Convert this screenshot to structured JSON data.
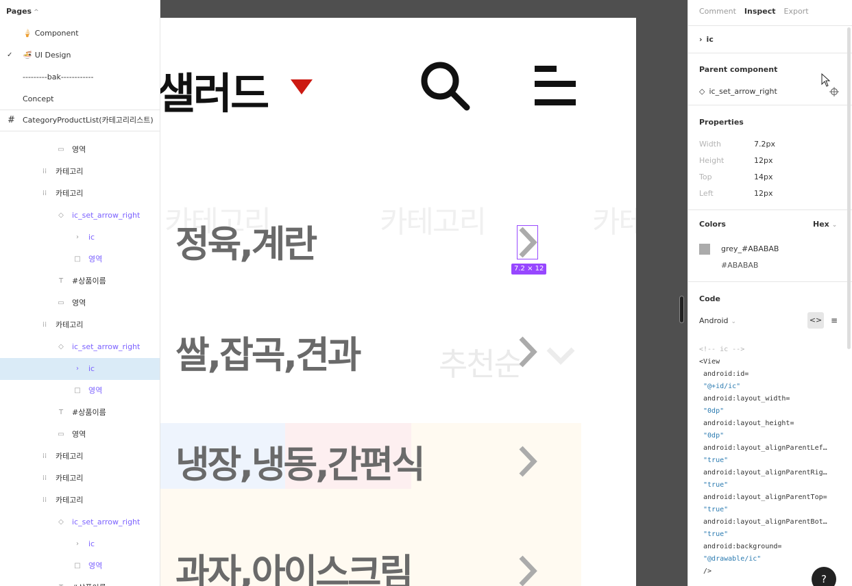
{
  "left_panel": {
    "pages_header": "Pages",
    "pages": [
      {
        "emoji": "🍦",
        "label": "Component",
        "checked": false
      },
      {
        "emoji": "🍜",
        "label": "UI Design",
        "checked": true
      },
      {
        "emoji": "",
        "label": "---------bak------------",
        "checked": false
      },
      {
        "emoji": "",
        "label": "Concept",
        "checked": false
      }
    ],
    "frame": "CategoryProductList(카테고리리스트)",
    "layers": [
      {
        "icon": "rect",
        "label": "영역",
        "purple": false,
        "selected": false
      },
      {
        "icon": "frame",
        "label": "카테고리",
        "purple": false,
        "selected": false
      },
      {
        "icon": "frame",
        "label": "카테고리",
        "purple": false,
        "selected": false
      },
      {
        "icon": "component",
        "label": "ic_set_arrow_right",
        "purple": true,
        "selected": false
      },
      {
        "icon": "chev",
        "label": "ic",
        "purple": true,
        "selected": false
      },
      {
        "icon": "square",
        "label": "영역",
        "purple": true,
        "selected": false
      },
      {
        "icon": "text",
        "label": "#상품이름",
        "purple": false,
        "selected": false
      },
      {
        "icon": "rect",
        "label": "영역",
        "purple": false,
        "selected": false
      },
      {
        "icon": "frame",
        "label": "카테고리",
        "purple": false,
        "selected": false
      },
      {
        "icon": "component",
        "label": "ic_set_arrow_right",
        "purple": true,
        "selected": false
      },
      {
        "icon": "chev",
        "label": "ic",
        "purple": true,
        "selected": true
      },
      {
        "icon": "square",
        "label": "영역",
        "purple": true,
        "selected": false
      },
      {
        "icon": "text",
        "label": "#상품이름",
        "purple": false,
        "selected": false
      },
      {
        "icon": "rect",
        "label": "영역",
        "purple": false,
        "selected": false
      },
      {
        "icon": "frame",
        "label": "카테고리",
        "purple": false,
        "selected": false
      },
      {
        "icon": "frame",
        "label": "카테고리",
        "purple": false,
        "selected": false
      },
      {
        "icon": "frame",
        "label": "카테고리",
        "purple": false,
        "selected": false
      },
      {
        "icon": "component",
        "label": "ic_set_arrow_right",
        "purple": true,
        "selected": false
      },
      {
        "icon": "chev",
        "label": "ic",
        "purple": true,
        "selected": false
      },
      {
        "icon": "square",
        "label": "영역",
        "purple": true,
        "selected": false
      },
      {
        "icon": "text",
        "label": "#상품이름",
        "purple": false,
        "selected": false
      }
    ]
  },
  "canvas": {
    "title": "샐러드",
    "ghost_label": "카테고리",
    "categories": [
      "정육,계란",
      "쌀,잡곡,견과",
      "냉장,냉동,간편식",
      "과자,아이스크림"
    ],
    "ghost_sort": "추천순",
    "size_badge": "7.2 × 12",
    "accent_red": "#CC1A12",
    "arrow_color": "#ABABAB",
    "selection_color": "#9747FF"
  },
  "right_panel": {
    "tabs": [
      {
        "label": "Comment",
        "active": false
      },
      {
        "label": "Inspect",
        "active": true
      },
      {
        "label": "Export",
        "active": false
      }
    ],
    "layer_name": "ic",
    "parent_title": "Parent component",
    "parent_name": "ic_set_arrow_right",
    "properties_title": "Properties",
    "properties": [
      {
        "key": "Width",
        "value": "7.2px"
      },
      {
        "key": "Height",
        "value": "12px"
      },
      {
        "key": "Top",
        "value": "14px"
      },
      {
        "key": "Left",
        "value": "12px"
      }
    ],
    "colors_title": "Colors",
    "color_format": "Hex",
    "color_name": "grey_#ABABAB",
    "color_hex": "#ABABAB",
    "code_title": "Code",
    "code_lang": "Android",
    "code_comment": "<!-- ic -->",
    "code_lines": [
      "<View",
      " android:id=",
      " \"@+id/ic\"",
      " android:layout_width=",
      " \"0dp\"",
      " android:layout_height=",
      " \"0dp\"",
      " android:layout_alignParentLef…",
      " \"true\"",
      " android:layout_alignParentRig…",
      " \"true\"",
      " android:layout_alignParentTop=",
      " \"true\"",
      " android:layout_alignParentBot…",
      " \"true\"",
      " android:background=",
      " \"@drawable/ic\"",
      " />"
    ],
    "help": "?"
  }
}
